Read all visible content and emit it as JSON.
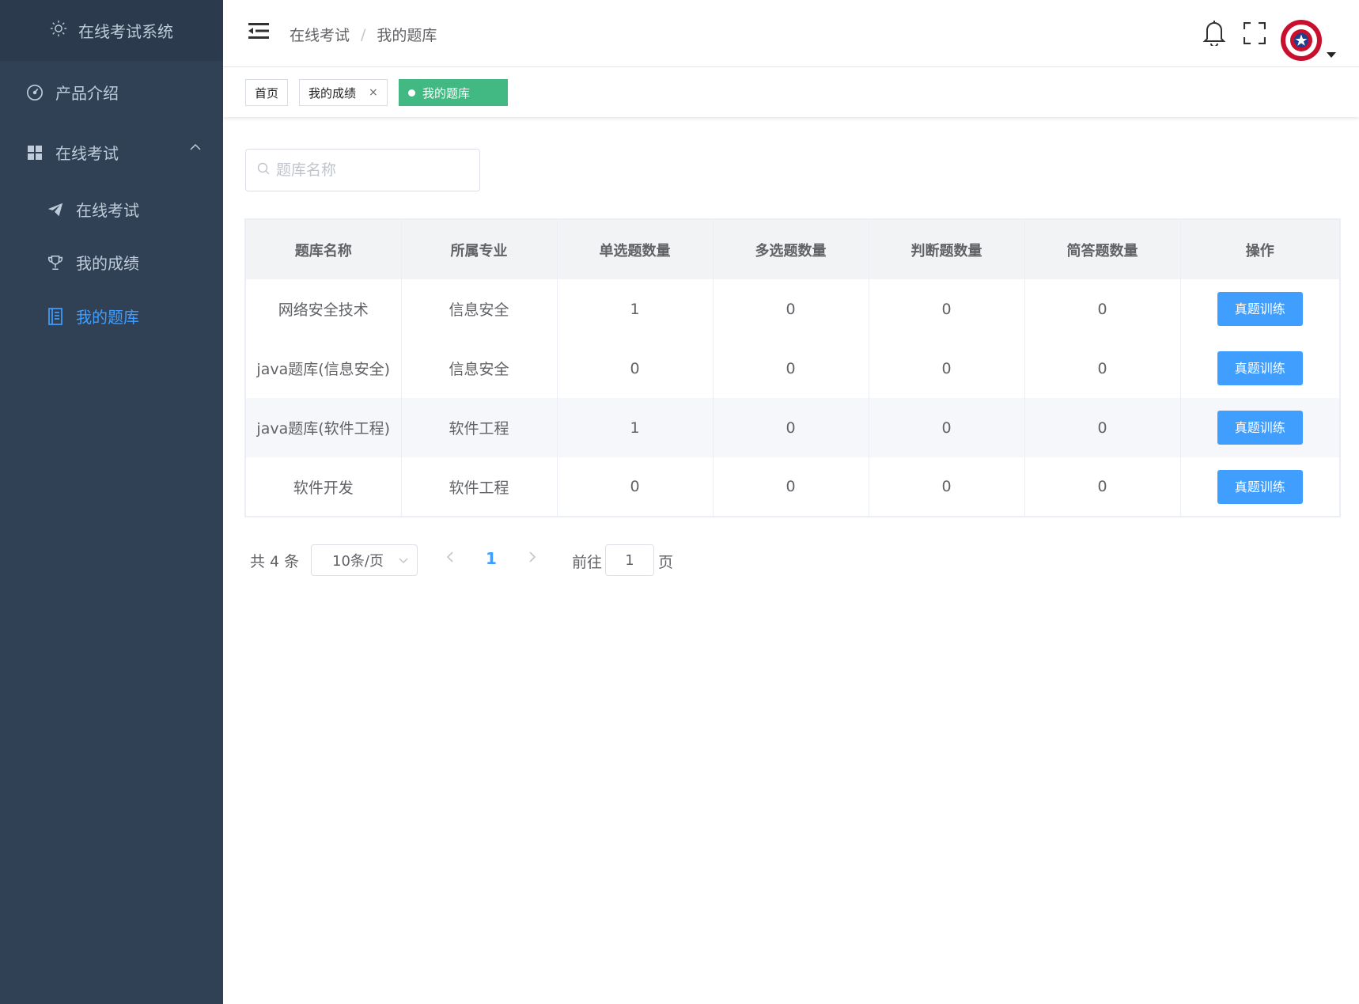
{
  "app": {
    "title": "在线考试系统"
  },
  "sidebar": {
    "items": [
      {
        "label": "产品介绍",
        "icon": "dashboard-icon"
      },
      {
        "label": "在线考试",
        "icon": "grid-icon",
        "expanded": true
      },
      {
        "label": "在线考试",
        "icon": "paper-plane-icon"
      },
      {
        "label": "我的成绩",
        "icon": "trophy-icon"
      },
      {
        "label": "我的题库",
        "icon": "document-icon",
        "active": true
      }
    ]
  },
  "header": {
    "breadcrumb": [
      "在线考试",
      "我的题库"
    ],
    "breadcrumb_sep": "/"
  },
  "tags": [
    {
      "label": "首页"
    },
    {
      "label": "我的成绩",
      "closable": true,
      "close": "×"
    },
    {
      "label": "我的题库",
      "active": true
    }
  ],
  "search": {
    "placeholder": "题库名称",
    "value": ""
  },
  "table": {
    "columns": [
      "题库名称",
      "所属专业",
      "单选题数量",
      "多选题数量",
      "判断题数量",
      "简答题数量",
      "操作"
    ],
    "rows": [
      {
        "name": "网络安全技术",
        "major": "信息安全",
        "single": "1",
        "multi": "0",
        "judge": "0",
        "short": "0",
        "action": "真题训练"
      },
      {
        "name": "java题库(信息安全)",
        "major": "信息安全",
        "single": "0",
        "multi": "0",
        "judge": "0",
        "short": "0",
        "action": "真题训练"
      },
      {
        "name": "java题库(软件工程)",
        "major": "软件工程",
        "single": "1",
        "multi": "0",
        "judge": "0",
        "short": "0",
        "action": "真题训练"
      },
      {
        "name": "软件开发",
        "major": "软件工程",
        "single": "0",
        "multi": "0",
        "judge": "0",
        "short": "0",
        "action": "真题训练"
      }
    ]
  },
  "pagination": {
    "total_text": "共 4 条",
    "page_size": "10条/页",
    "current_page": "1",
    "goto_label": "前往",
    "goto_value": "1",
    "page_unit": "页"
  },
  "colors": {
    "sidebar_bg": "#304156",
    "accent": "#409eff",
    "active_tag": "#42b983"
  }
}
